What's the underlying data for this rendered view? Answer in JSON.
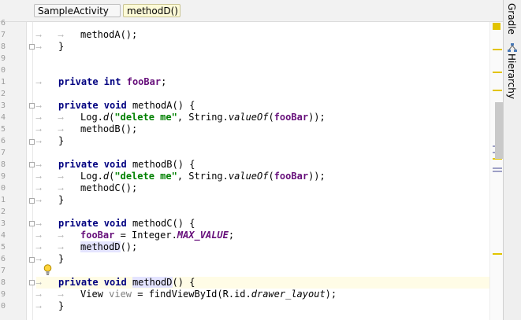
{
  "breadcrumbs": [
    {
      "label": "SampleActivity"
    },
    {
      "label": "methodD()"
    }
  ],
  "side_tabs": {
    "gradle": "Gradle",
    "hierarchy": "Hierarchy"
  },
  "code": {
    "line_numbers": [
      "6",
      "7",
      "8",
      "9",
      "0",
      "1",
      "2",
      "3",
      "4",
      "5",
      "6",
      "7",
      "8",
      "9",
      "0",
      "1",
      "2",
      "3",
      "4",
      "5",
      "6",
      "7",
      "8",
      "9",
      "0"
    ],
    "lines": {
      "l7": {
        "text": "methodA();"
      },
      "l8": {
        "text": "}"
      },
      "l11": {
        "kw": "private int",
        "field": "fooBar",
        "tail": ";"
      },
      "l13": {
        "kw": "private void",
        "name": "methodA",
        "tail": "() {"
      },
      "l14": {
        "pre": "Log.",
        "ital": "d",
        "open": "(",
        "str": "\"delete me\"",
        "mid": ", String.",
        "ital2": "valueOf",
        "open2": "(",
        "field": "fooBar",
        "close": "));"
      },
      "l15": {
        "text": "methodB();"
      },
      "l16": {
        "text": "}"
      },
      "l18": {
        "kw": "private void",
        "name": "methodB",
        "tail": "() {"
      },
      "l19": {
        "pre": "Log.",
        "ital": "d",
        "open": "(",
        "str": "\"delete me\"",
        "mid": ", String.",
        "ital2": "valueOf",
        "open2": "(",
        "field": "fooBar",
        "close": "));"
      },
      "l20": {
        "text": "methodC();"
      },
      "l21": {
        "text": "}"
      },
      "l23": {
        "kw": "private void",
        "name": "methodC",
        "tail": "() {"
      },
      "l24": {
        "field": "fooBar",
        "mid": " = Integer.",
        "const": "MAX_VALUE",
        "tail": ";"
      },
      "l25": {
        "ref": "methodD",
        "tail": "();"
      },
      "l26": {
        "text": "}"
      },
      "l28": {
        "kw": "private void",
        "decl": "methodD",
        "tail": "() {"
      },
      "l29": {
        "pre": "View ",
        "unused": "view",
        "mid": " = findViewById(R.id.",
        "ital": "drawer_layout",
        "tail": ");"
      },
      "l30": {
        "text": "}"
      }
    }
  },
  "colors": {
    "keyword": "#000080",
    "field": "#660e7a",
    "string": "#008000",
    "warning_marker": "#e2c400",
    "current_line": "#fffce6"
  },
  "icons": {
    "intention": "lightbulb-icon",
    "fold": "fold-toggle-icon"
  }
}
